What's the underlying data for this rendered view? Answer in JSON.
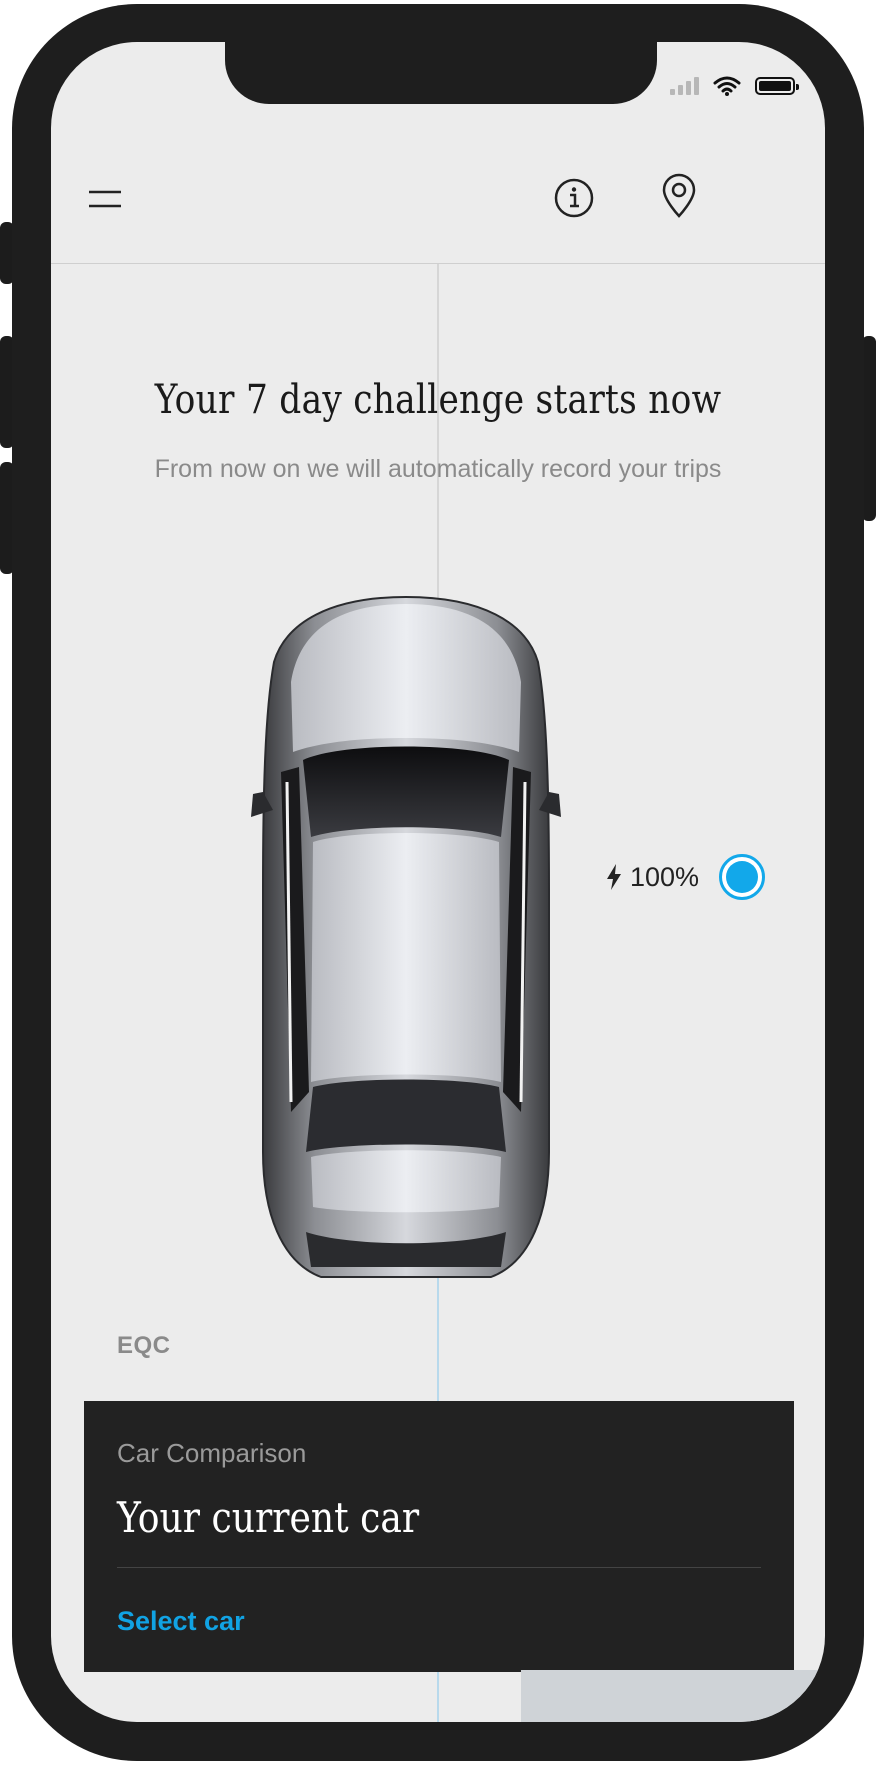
{
  "header": {
    "menu_icon": "hamburger-menu-icon",
    "info_icon": "info-icon",
    "location_icon": "location-pin-icon"
  },
  "challenge": {
    "title": "Your 7 day challenge starts now",
    "subtitle": "From now on we will automatically record your trips"
  },
  "vehicle": {
    "battery_icon": "lightning-bolt-icon",
    "battery_level": "100%",
    "model": "EQC",
    "accent_color": "#12a8ea"
  },
  "comparison_card": {
    "label": "Car Comparison",
    "title": "Your current car",
    "link": "Select car",
    "link_color": "#11a3e4"
  }
}
